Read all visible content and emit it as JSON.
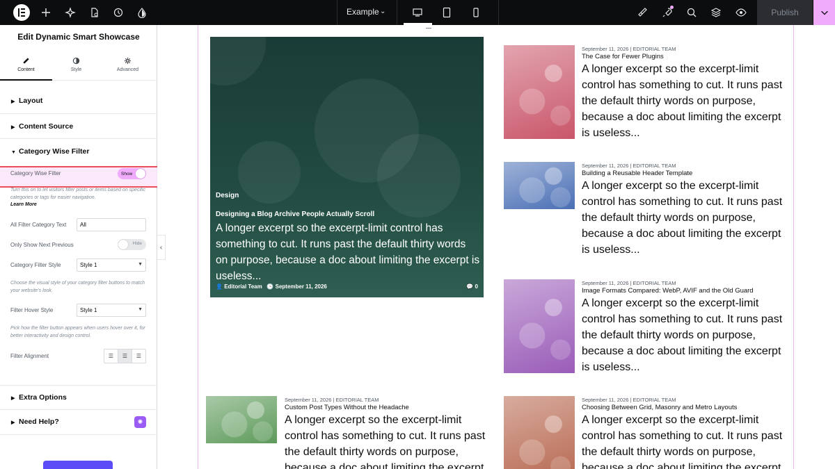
{
  "topbar": {
    "site_name": "Example",
    "publish_label": "Publish"
  },
  "panel": {
    "title": "Edit Dynamic Smart Showcase",
    "tabs": [
      {
        "label": "Content",
        "icon": "pencil-icon"
      },
      {
        "label": "Style",
        "icon": "half-circle-icon"
      },
      {
        "label": "Advanced",
        "icon": "gear-icon"
      }
    ],
    "sections": {
      "layout": "Layout",
      "content_source": "Content Source",
      "category_filter": "Category Wise Filter",
      "extra_options": "Extra Options",
      "need_help": "Need Help?"
    },
    "controls": {
      "category_wise_filter_label": "Category Wise Filter",
      "category_wise_filter_toggle": "Show",
      "category_wise_filter_help": "Turn this on to let visitors filter posts or items based on specific categories or tags for easier navigation.",
      "learn_more": "Learn More",
      "all_filter_text_label": "All Filter Category Text",
      "all_filter_text_value": "All",
      "only_show_next_prev_label": "Only Show Next Previous",
      "only_show_next_prev_toggle": "Hide",
      "category_filter_style_label": "Category Filter Style",
      "category_filter_style_value": "Style 1",
      "category_filter_style_help": "Choose the visual style of your category filter buttons to match your website's look.",
      "filter_hover_style_label": "Filter Hover Style",
      "filter_hover_style_value": "Style 1",
      "filter_hover_style_help": "Pick how the filter button appears when users hover over it, for better interactivity and design control.",
      "filter_alignment_label": "Filter Alignment"
    }
  },
  "featured": {
    "category": "Design",
    "title": "Designing a Blog Archive People Actually Scroll",
    "excerpt": "A longer excerpt so the excerpt-limit control has something to cut. It runs past the default thirty words on purpose, because a doc about limiting the excerpt is useless...",
    "author": "Editorial Team",
    "date": "September 11, 2026",
    "comments": "0"
  },
  "posts": [
    {
      "meta": "September 11, 2026 | EDITORIAL TEAM",
      "title": "The Case for Fewer Plugins",
      "excerpt": "A longer excerpt so the excerpt-limit control has something to cut. It runs past the default thirty words on purpose, because a doc about limiting the excerpt is useless...",
      "color": "#c9566a"
    },
    {
      "meta": "September 11, 2026 | EDITORIAL TEAM",
      "title": "Building a Reusable Header Template",
      "excerpt": "A longer excerpt so the excerpt-limit control has something to cut. It runs past the default thirty words on purpose, because a doc about limiting the excerpt is useless...",
      "color": "#4a6fb5"
    },
    {
      "meta": "September 11, 2026 | EDITORIAL TEAM",
      "title": "Image Formats Compared: WebP, AVIF and the Old Guard",
      "excerpt": "A longer excerpt so the excerpt-limit control has something to cut. It runs past the default thirty words on purpose, because a doc about limiting the excerpt is useless...",
      "color": "#9a5cb8"
    },
    {
      "meta": "September 11, 2026 | EDITORIAL TEAM",
      "title": "Custom Post Types Without the Headache",
      "excerpt": "A longer excerpt so the excerpt-limit control has something to cut. It runs past the default thirty words on purpose, because a doc about limiting the excerpt is useless...",
      "color": "#5d9a5a"
    },
    {
      "meta": "September 11, 2026 | EDITORIAL TEAM",
      "title": "Choosing Between Grid, Masonry and Metro Layouts",
      "excerpt": "A longer excerpt so the excerpt-limit control has something to cut. It runs past the default thirty words on purpose, because a doc about limiting the excerpt is useless...",
      "color": "#b5634a"
    }
  ],
  "colors": {
    "accent": "#f0abfc",
    "highlight_border": "#e93a4b",
    "topbar_bg": "#0c0d0e"
  }
}
